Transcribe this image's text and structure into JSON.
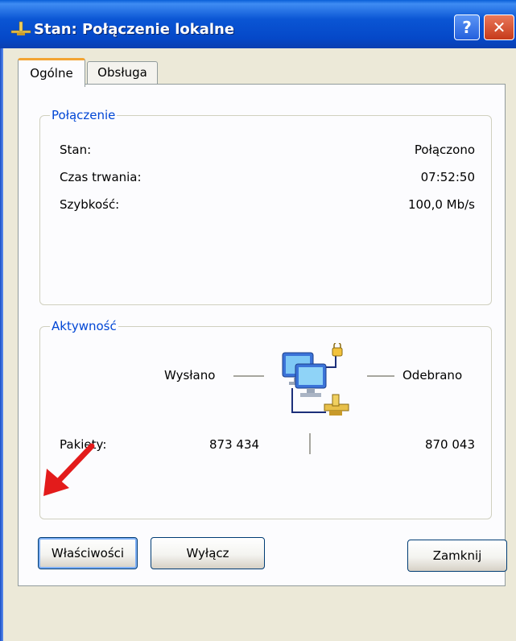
{
  "window": {
    "title": "Stan: Połączenie lokalne",
    "help_label": "?",
    "close_label": "✕"
  },
  "tabs": [
    {
      "label": "Ogólne",
      "active": true
    },
    {
      "label": "Obsługa",
      "active": false
    }
  ],
  "connection": {
    "group_label": "Połączenie",
    "rows": [
      {
        "label": "Stan:",
        "value": "Połączono"
      },
      {
        "label": "Czas trwania:",
        "value": "07:52:50"
      },
      {
        "label": "Szybkość:",
        "value": "100,0 Mb/s"
      }
    ]
  },
  "activity": {
    "group_label": "Aktywność",
    "sent_label": "Wysłano",
    "received_label": "Odebrano",
    "packets_label": "Pakiety:",
    "packets_sent": "873 434",
    "packets_received": "870 043",
    "icon": "network-computers-icon"
  },
  "buttons": {
    "properties": "Właściwości",
    "disable": "Wyłącz",
    "close": "Zamknij"
  },
  "colors": {
    "titlebar": "#0a55d4",
    "group_label": "#0046d5",
    "active_tab_accent": "#f3a432",
    "annotation_arrow": "#e31b1b"
  }
}
